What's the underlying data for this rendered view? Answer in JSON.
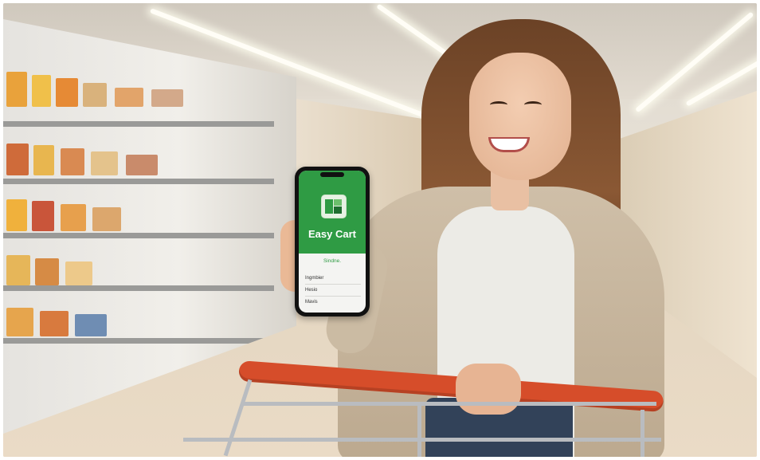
{
  "scene": "woman-shopping-with-phone-app",
  "colors": {
    "app_green": "#2f9b44",
    "cart_handle": "#d64d2a",
    "cardigan": "#c6b59c"
  },
  "phone_app": {
    "title": "Easy Cart",
    "tagline": "Sindne.",
    "menu_items": [
      "Ingmbier",
      "Hesio",
      "Mavis"
    ],
    "icon": "grid-logo-icon"
  }
}
